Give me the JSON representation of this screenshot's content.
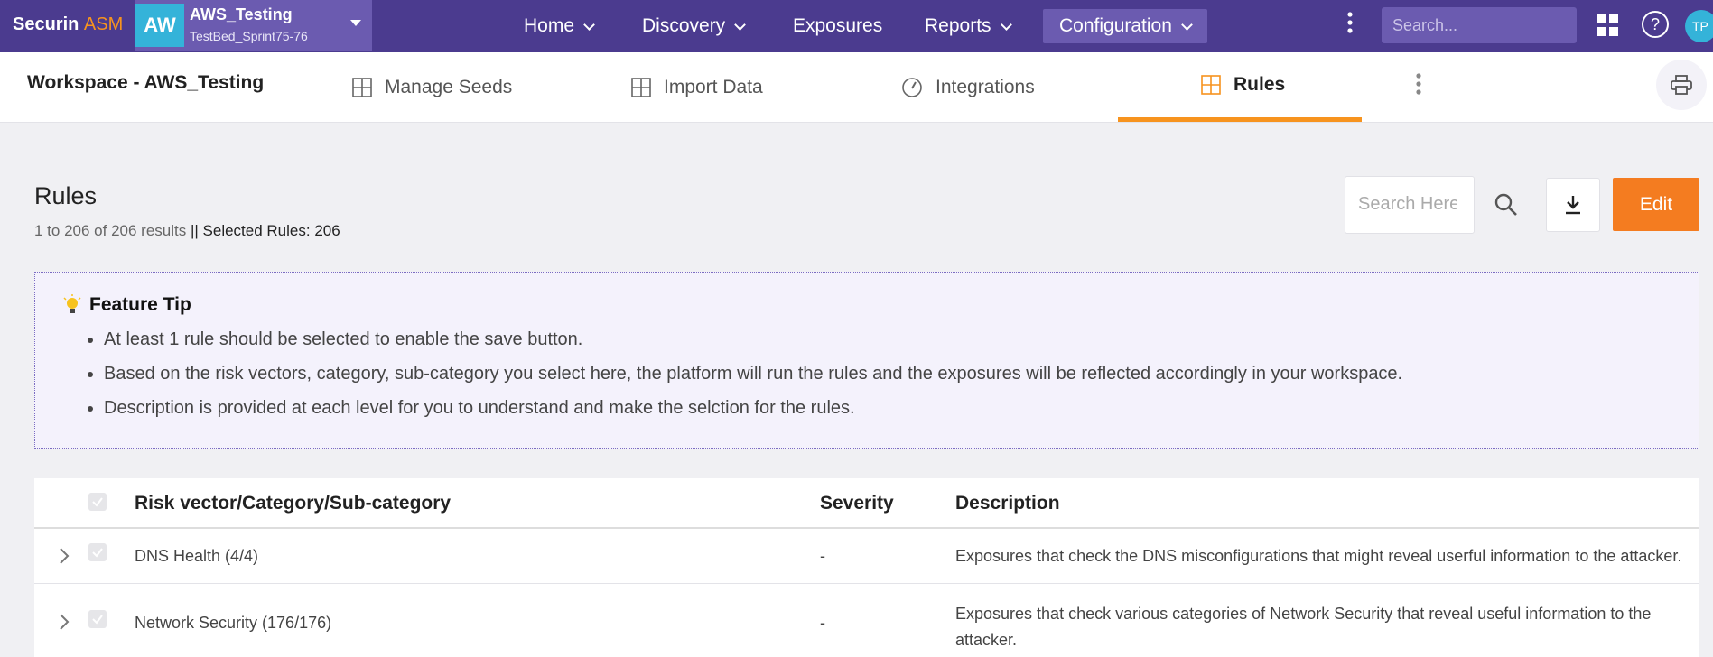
{
  "brand": {
    "name": "Securin",
    "suffix": "ASM"
  },
  "workspace_switcher": {
    "avatar": "AW",
    "name": "AWS_Testing",
    "subtitle": "TestBed_Sprint75-76"
  },
  "nav": {
    "home": "Home",
    "discovery": "Discovery",
    "exposures": "Exposures",
    "reports": "Reports",
    "configuration": "Configuration"
  },
  "top_search": {
    "placeholder": "Search..."
  },
  "help": "?",
  "user": {
    "initials": "TP"
  },
  "subheader": {
    "title": "Workspace - AWS_Testing",
    "tabs": [
      {
        "label": "Manage Seeds",
        "icon": "grid-icon"
      },
      {
        "label": "Import Data",
        "icon": "grid-icon"
      },
      {
        "label": "Integrations",
        "icon": "gauge-icon"
      },
      {
        "label": "Rules",
        "icon": "grid-icon",
        "active": true
      }
    ]
  },
  "page": {
    "title": "Rules",
    "results": "1 to 206 of 206 results",
    "selected": "|| Selected Rules: 206",
    "search_placeholder": "Search Here",
    "edit_label": "Edit"
  },
  "feature_tip": {
    "title": "Feature Tip",
    "items": [
      "At least 1 rule should be selected to enable the save button.",
      "Based on the risk vectors, category, sub-category you select here, the platform will run the rules and the exposures will be reflected accordingly in your workspace.",
      "Description is provided at each level for you to understand and make the selction for the rules."
    ]
  },
  "table": {
    "headers": {
      "name": "Risk vector/Category/Sub-category",
      "severity": "Severity",
      "description": "Description"
    },
    "rows": [
      {
        "name": "DNS Health (4/4)",
        "severity": "-",
        "description": "Exposures that check the DNS misconfigurations that might reveal userful information to the attacker."
      },
      {
        "name": "Network Security (176/176)",
        "severity": "-",
        "description_line1": "Exposures that check various categories of Network Security that reveal useful information to the",
        "description_line2": "attacker."
      }
    ]
  },
  "colors": {
    "nav_bg": "#4b3b8f",
    "accent": "#f47c20",
    "tip_bg": "#f4f2fc"
  }
}
